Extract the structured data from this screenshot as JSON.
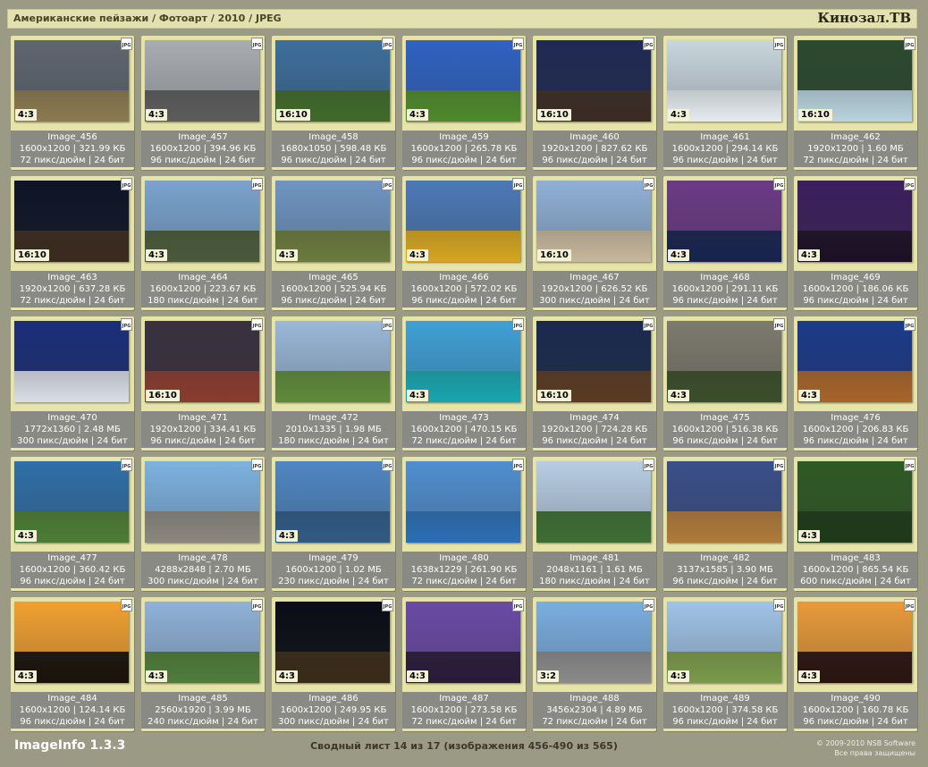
{
  "header": {
    "breadcrumb": "Американские пейзажи / Фотоарт / 2010 / JPEG",
    "brand": "Кинозал.ТВ"
  },
  "images": [
    {
      "name": "Image_456",
      "dims": "1600x1200",
      "size": "321.99 КБ",
      "dpi": "72 пикс/дюйм",
      "bits": "24 бит",
      "ratio": "4:3",
      "sky": "#5e6670",
      "land": "#8b7a4f"
    },
    {
      "name": "Image_457",
      "dims": "1600x1200",
      "size": "394.96 КБ",
      "dpi": "96 пикс/дюйм",
      "bits": "24 бит",
      "ratio": "4:3",
      "sky": "#a9adb2",
      "land": "#5c5c5c"
    },
    {
      "name": "Image_458",
      "dims": "1680x1050",
      "size": "598.48 КБ",
      "dpi": "96 пикс/дюйм",
      "bits": "24 бит",
      "ratio": "16:10",
      "sky": "#3d6e9c",
      "land": "#3f6a2a"
    },
    {
      "name": "Image_459",
      "dims": "1600x1200",
      "size": "265.78 КБ",
      "dpi": "96 пикс/дюйм",
      "bits": "24 бит",
      "ratio": "4:3",
      "sky": "#2f62c4",
      "land": "#4d8a2a"
    },
    {
      "name": "Image_460",
      "dims": "1920x1200",
      "size": "827.62 КБ",
      "dpi": "96 пикс/дюйм",
      "bits": "24 бит",
      "ratio": "16:10",
      "sky": "#1f2a55",
      "land": "#3a2c24"
    },
    {
      "name": "Image_461",
      "dims": "1600x1200",
      "size": "294.14 КБ",
      "dpi": "96 пикс/дюйм",
      "bits": "24 бит",
      "ratio": "4:3",
      "sky": "#c9d6df",
      "land": "#e5ebef"
    },
    {
      "name": "Image_462",
      "dims": "1920x1200",
      "size": "1.60 МБ",
      "dpi": "72 пикс/дюйм",
      "bits": "24 бит",
      "ratio": "16:10",
      "sky": "#2b4a2f",
      "land": "#b8d4de"
    },
    {
      "name": "Image_463",
      "dims": "1920x1200",
      "size": "637.28 КБ",
      "dpi": "72 пикс/дюйм",
      "bits": "24 бит",
      "ratio": "16:10",
      "sky": "#0d1426",
      "land": "#3b2a1e"
    },
    {
      "name": "Image_464",
      "dims": "1600x1200",
      "size": "223.67 КБ",
      "dpi": "180 пикс/дюйм",
      "bits": "24 бит",
      "ratio": "4:3",
      "sky": "#7aa3cf",
      "land": "#4a5a3a"
    },
    {
      "name": "Image_465",
      "dims": "1600x1200",
      "size": "525.94 КБ",
      "dpi": "96 пикс/дюйм",
      "bits": "24 бит",
      "ratio": "4:3",
      "sky": "#6e95c2",
      "land": "#6a7b3c"
    },
    {
      "name": "Image_466",
      "dims": "1600x1200",
      "size": "572.02 КБ",
      "dpi": "96 пикс/дюйм",
      "bits": "24 бит",
      "ratio": "4:3",
      "sky": "#4b79b6",
      "land": "#d6a51f"
    },
    {
      "name": "Image_467",
      "dims": "1920x1200",
      "size": "626.52 КБ",
      "dpi": "300 пикс/дюйм",
      "bits": "24 бит",
      "ratio": "16:10",
      "sky": "#8fb0d6",
      "land": "#c8b79d"
    },
    {
      "name": "Image_468",
      "dims": "1600x1200",
      "size": "291.11 КБ",
      "dpi": "96 пикс/дюйм",
      "bits": "24 бит",
      "ratio": "4:3",
      "sky": "#6b3a86",
      "land": "#17234f"
    },
    {
      "name": "Image_469",
      "dims": "1600x1200",
      "size": "186.06 КБ",
      "dpi": "96 пикс/дюйм",
      "bits": "24 бит",
      "ratio": "4:3",
      "sky": "#3b1f5e",
      "land": "#1c0f25"
    },
    {
      "name": "Image_470",
      "dims": "1772x1360",
      "size": "2.48 МБ",
      "dpi": "300 пикс/дюйм",
      "bits": "24 бит",
      "ratio": "",
      "sky": "#1a2e7a",
      "land": "#d9dde6"
    },
    {
      "name": "Image_471",
      "dims": "1920x1200",
      "size": "334.41 КБ",
      "dpi": "96 пикс/дюйм",
      "bits": "24 бит",
      "ratio": "16:10",
      "sky": "#3a3140",
      "land": "#8a3b2e"
    },
    {
      "name": "Image_472",
      "dims": "2010x1335",
      "size": "1.98 МБ",
      "dpi": "180 пикс/дюйм",
      "bits": "24 бит",
      "ratio": "",
      "sky": "#9ab8d8",
      "land": "#5f8a3a"
    },
    {
      "name": "Image_473",
      "dims": "1600x1200",
      "size": "470.15 КБ",
      "dpi": "72 пикс/дюйм",
      "bits": "24 бит",
      "ratio": "4:3",
      "sky": "#3fa0d6",
      "land": "#18a6b0"
    },
    {
      "name": "Image_474",
      "dims": "1920x1200",
      "size": "724.28 КБ",
      "dpi": "96 пикс/дюйм",
      "bits": "24 бит",
      "ratio": "16:10",
      "sky": "#1a2a4f",
      "land": "#5a3a22"
    },
    {
      "name": "Image_475",
      "dims": "1600x1200",
      "size": "516.38 КБ",
      "dpi": "96 пикс/дюйм",
      "bits": "24 бит",
      "ratio": "4:3",
      "sky": "#7d7a6e",
      "land": "#3a4e2a"
    },
    {
      "name": "Image_476",
      "dims": "1600x1200",
      "size": "206.83 КБ",
      "dpi": "96 пикс/дюйм",
      "bits": "24 бит",
      "ratio": "4:3",
      "sky": "#1b3a8a",
      "land": "#a8642a"
    },
    {
      "name": "Image_477",
      "dims": "1600x1200",
      "size": "360.42 КБ",
      "dpi": "96 пикс/дюйм",
      "bits": "24 бит",
      "ratio": "4:3",
      "sky": "#2f6fa8",
      "land": "#4c7d34"
    },
    {
      "name": "Image_478",
      "dims": "4288x2848",
      "size": "2.70 МБ",
      "dpi": "300 пикс/дюйм",
      "bits": "24 бит",
      "ratio": "",
      "sky": "#7db2e0",
      "land": "#8a8780"
    },
    {
      "name": "Image_479",
      "dims": "1600x1200",
      "size": "1.02 МБ",
      "dpi": "230 пикс/дюйм",
      "bits": "24 бит",
      "ratio": "4:3",
      "sky": "#4f86c2",
      "land": "#2f5a86"
    },
    {
      "name": "Image_480",
      "dims": "1638x1229",
      "size": "261.90 КБ",
      "dpi": "72 пикс/дюйм",
      "bits": "24 бит",
      "ratio": "",
      "sky": "#4f8fd0",
      "land": "#2a6fb4"
    },
    {
      "name": "Image_481",
      "dims": "2048x1161",
      "size": "1.61 МБ",
      "dpi": "180 пикс/дюйм",
      "bits": "24 бит",
      "ratio": "",
      "sky": "#b7cde4",
      "land": "#3d6e34"
    },
    {
      "name": "Image_482",
      "dims": "3137x1585",
      "size": "3.90 МБ",
      "dpi": "96 пикс/дюйм",
      "bits": "24 бит",
      "ratio": "",
      "sky": "#3a4f8a",
      "land": "#b07a3a"
    },
    {
      "name": "Image_483",
      "dims": "1600x1200",
      "size": "865.54 КБ",
      "dpi": "600 пикс/дюйм",
      "bits": "24 бит",
      "ratio": "4:3",
      "sky": "#2f5a24",
      "land": "#1d3a18"
    },
    {
      "name": "Image_484",
      "dims": "1600x1200",
      "size": "124.14 КБ",
      "dpi": "96 пикс/дюйм",
      "bits": "24 бит",
      "ratio": "4:3",
      "sky": "#f0a030",
      "land": "#1a120a"
    },
    {
      "name": "Image_485",
      "dims": "2560x1920",
      "size": "3.99 МБ",
      "dpi": "240 пикс/дюйм",
      "bits": "24 бит",
      "ratio": "4:3",
      "sky": "#8fb2d8",
      "land": "#4f7d3a"
    },
    {
      "name": "Image_486",
      "dims": "1600x1200",
      "size": "249.95 КБ",
      "dpi": "300 пикс/дюйм",
      "bits": "24 бит",
      "ratio": "4:3",
      "sky": "#0a0d16",
      "land": "#3a2a18"
    },
    {
      "name": "Image_487",
      "dims": "1600x1200",
      "size": "273.58 КБ",
      "dpi": "72 пикс/дюйм",
      "bits": "24 бит",
      "ratio": "4:3",
      "sky": "#6a4aa6",
      "land": "#2a1a3a"
    },
    {
      "name": "Image_488",
      "dims": "3456x2304",
      "size": "4.89 МБ",
      "dpi": "72 пикс/дюйм",
      "bits": "24 бит",
      "ratio": "3:2",
      "sky": "#7aaee0",
      "land": "#8a8a8a"
    },
    {
      "name": "Image_489",
      "dims": "1600x1200",
      "size": "374.58 КБ",
      "dpi": "96 пикс/дюйм",
      "bits": "24 бит",
      "ratio": "4:3",
      "sky": "#9fc3e6",
      "land": "#7a9a4a"
    },
    {
      "name": "Image_490",
      "dims": "1600x1200",
      "size": "160.78 КБ",
      "dpi": "96 пикс/дюйм",
      "bits": "24 бит",
      "ratio": "4:3",
      "sky": "#e89a3a",
      "land": "#2a1410"
    }
  ],
  "jpg_label": "JPG",
  "footer": {
    "app": "ImageInfo 1.3.3",
    "summary": "Сводный лист 14 из 17 (изображения 456-490 из 565)",
    "copyright": "© 2009-2010 NSB Software",
    "rights": "Все права защищены"
  }
}
